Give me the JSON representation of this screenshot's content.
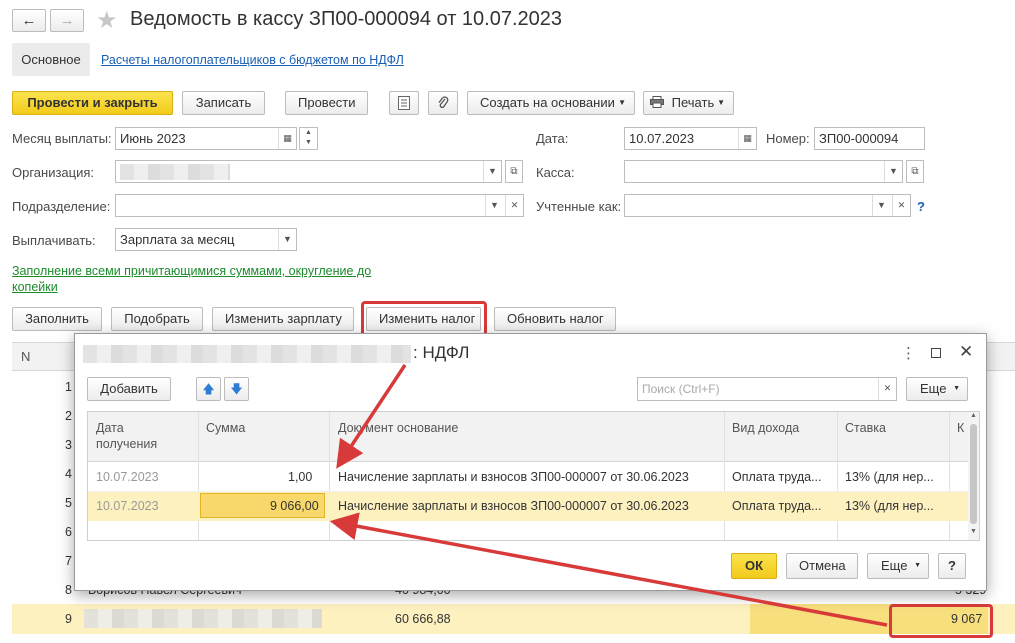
{
  "window": {
    "title": "Ведомость в кассу ЗП00-000094 от 10.07.2023",
    "nav_back": "←",
    "nav_forward": "→",
    "star": "★"
  },
  "tabs": {
    "main": "Основное",
    "ndfl_link": "Расчеты налогоплательщиков с бюджетом по НДФЛ"
  },
  "toolbar": {
    "post_close": "Провести и закрыть",
    "save": "Записать",
    "post": "Провести",
    "create_based": "Создать на основании",
    "print": "Печать"
  },
  "form": {
    "month_label": "Месяц выплаты:",
    "month_value": "Июнь 2023",
    "date_label": "Дата:",
    "date_value": "10.07.2023",
    "number_label": "Номер:",
    "number_value": "ЗП00-000094",
    "org_label": "Организация:",
    "cash_label": "Касса:",
    "dept_label": "Подразделение:",
    "accounted_label": "Учтенные как:",
    "help": "?",
    "pay_label": "Выплачивать:",
    "pay_value": "Зарплата за месяц",
    "fill_link": "Заполнение всеми причитающимися суммами, округление до копейки"
  },
  "actions": {
    "fill": "Заполнить",
    "pick": "Подобрать",
    "change_salary": "Изменить зарплату",
    "change_tax": "Изменить налог",
    "update_tax": "Обновить налог"
  },
  "main_table": {
    "header_n": "N",
    "row_numbers": [
      "1",
      "2",
      "3",
      "4",
      "5",
      "6",
      "7",
      "8",
      "9"
    ],
    "row8_name": "Борисов Павел Сергеевич",
    "row8_amount": "40 984,00",
    "row8_tax": "5 329",
    "row9_amount": "60 666,88",
    "row9_tax": "9 067"
  },
  "dialog": {
    "title_suffix": ": НДФЛ",
    "more_icon": "⋮",
    "add": "Добавить",
    "search_placeholder": "Поиск (Ctrl+F)",
    "more": "Еще",
    "columns": [
      "Дата получения",
      "Сумма",
      "Документ основание",
      "Вид дохода",
      "Ставка",
      "К"
    ],
    "rows": [
      {
        "date": "10.07.2023",
        "sum": "1,00",
        "doc": "Начисление зарплаты и взносов ЗП00-000007 от 30.06.2023",
        "income": "Оплата труда...",
        "rate": "13% (для нер..."
      },
      {
        "date": "10.07.2023",
        "sum": "9 066,00",
        "doc": "Начисление зарплаты и взносов ЗП00-000007 от 30.06.2023",
        "income": "Оплата труда...",
        "rate": "13% (для нер..."
      }
    ],
    "ok": "ОК",
    "cancel": "Отмена",
    "help": "?"
  },
  "colors": {
    "accent_yellow": "#f5d22a",
    "highlight_row": "#fdf1c0",
    "annotation_red": "#d83a3a",
    "link_blue": "#1a5fb4",
    "link_green": "#1c8b2c"
  }
}
